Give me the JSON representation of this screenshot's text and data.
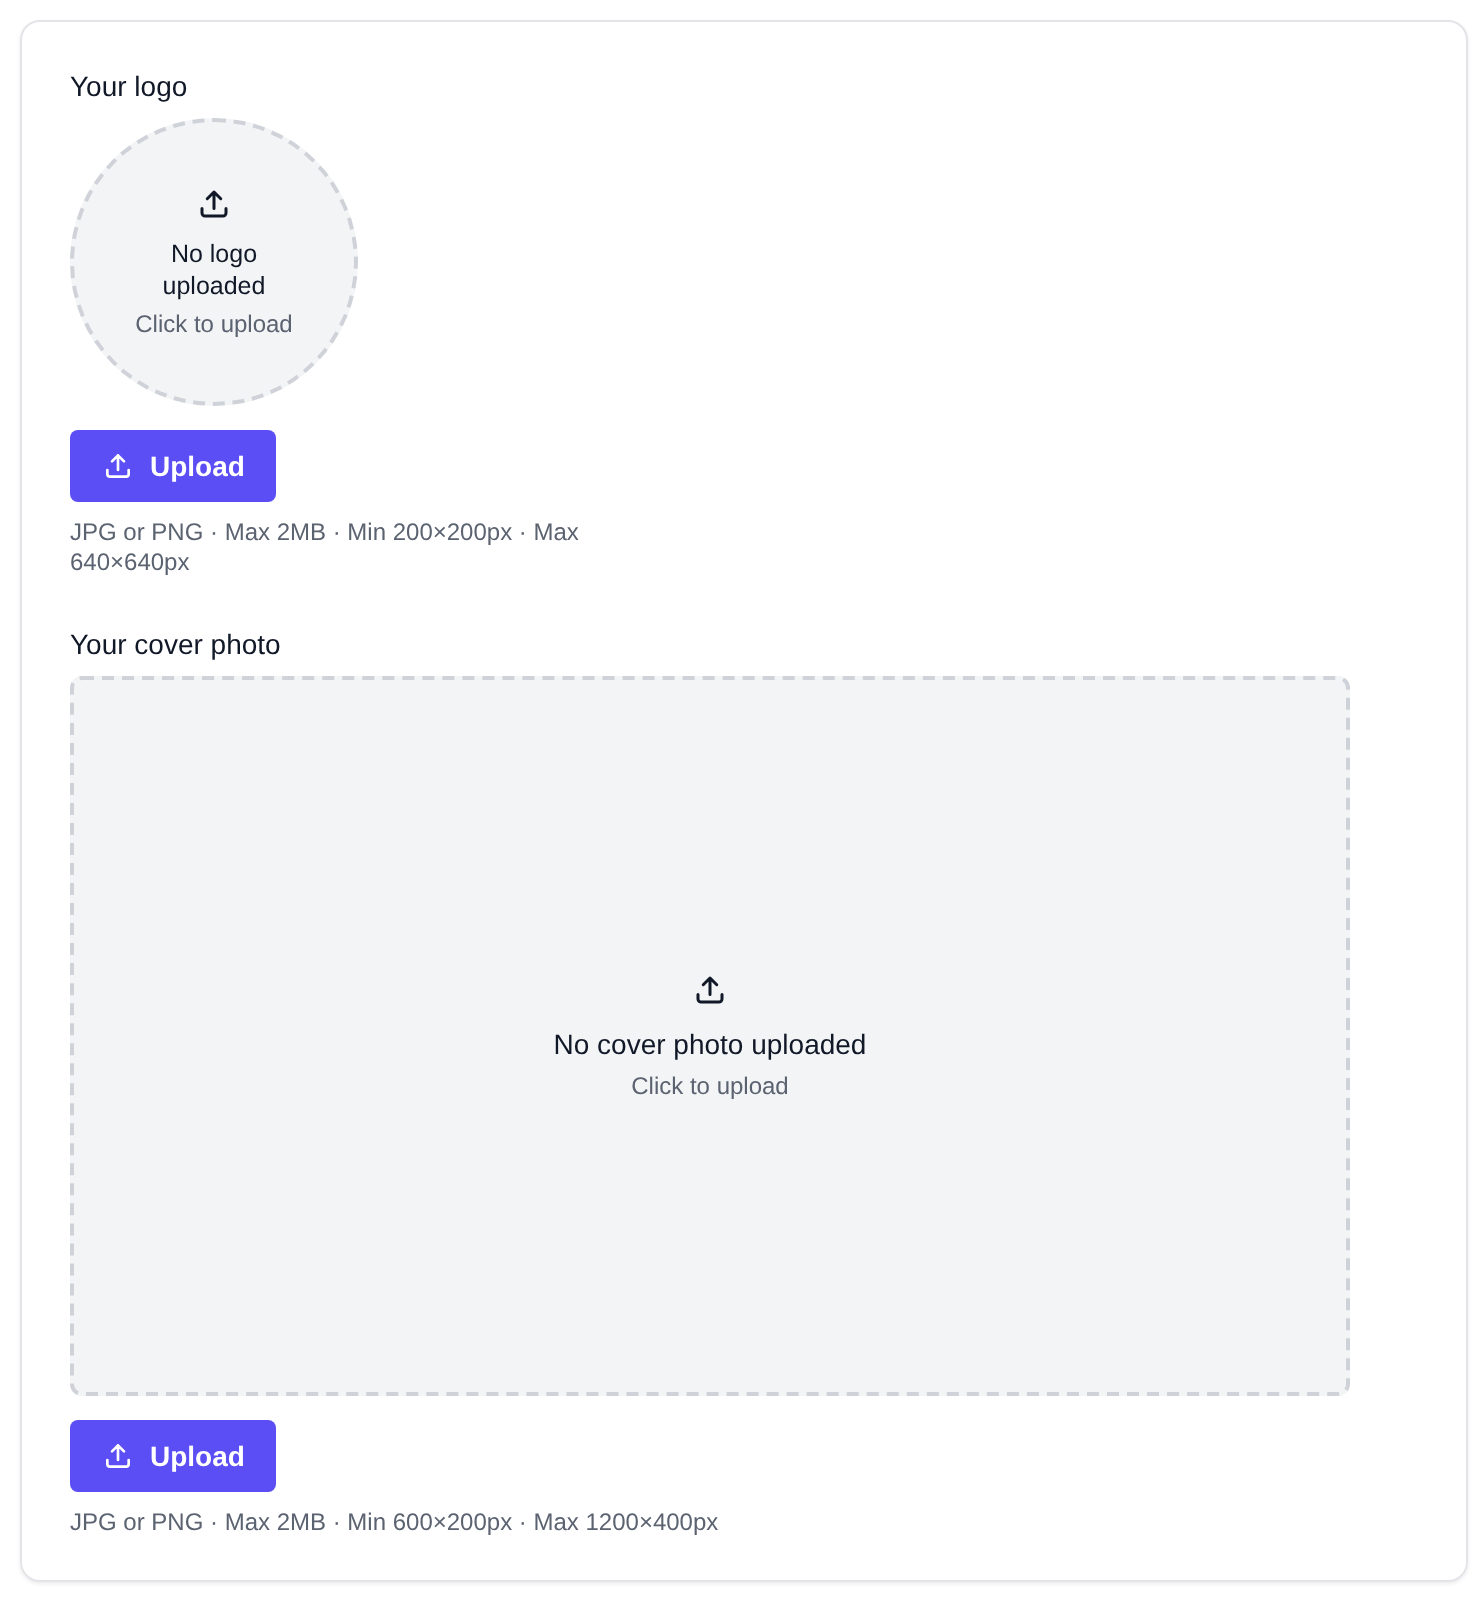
{
  "sections": [
    {
      "kind": "logo",
      "title": "Your logo",
      "empty_title": "No logo uploaded",
      "empty_hint": "Click to upload",
      "button": "Upload",
      "requirements": "JPG or PNG · Max 2MB · Min 200×200px · Max 640×640px"
    },
    {
      "kind": "cover",
      "title": "Your cover photo",
      "empty_title": "No cover photo uploaded",
      "empty_hint": "Click to upload",
      "button": "Upload",
      "requirements": "JPG or PNG · Max 2MB · Min 600×200px · Max 1200×400px"
    }
  ]
}
